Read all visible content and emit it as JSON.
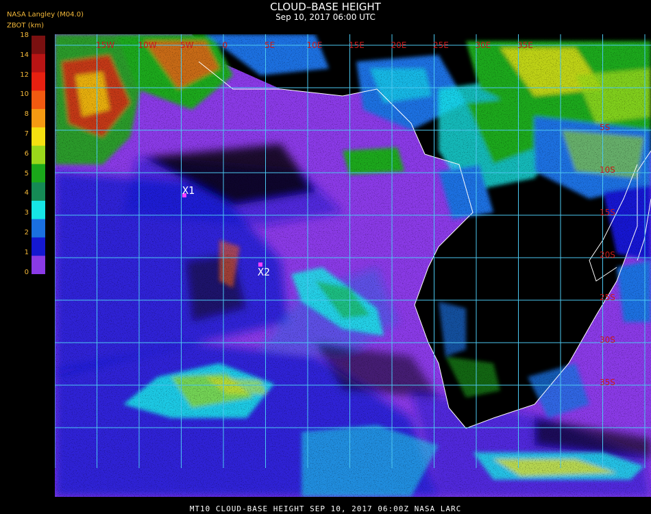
{
  "header": {
    "source": "NASA Langley (M04.0)",
    "units": "ZBOT (km)",
    "title": "CLOUD–BASE HEIGHT",
    "subtitle": "Sep 10, 2017 06:00 UTC"
  },
  "colorbar": {
    "ticks": [
      "18",
      "14",
      "12",
      "10",
      "8",
      "7",
      "6",
      "5",
      "4",
      "3",
      "2",
      "1",
      "0"
    ],
    "colors": [
      "#7a1010",
      "#b81414",
      "#e82010",
      "#f25a10",
      "#f59a12",
      "#f5e010",
      "#9ad71a",
      "#1aa81a",
      "#158a55",
      "#16e6e6",
      "#1a70e0",
      "#1418d0",
      "#8a3ae6"
    ]
  },
  "map": {
    "lon_labels": [
      "15W",
      "10W",
      "5W",
      "0",
      "5E",
      "10E",
      "15E",
      "20E",
      "25E",
      "30E",
      "35E"
    ],
    "lat_labels": [
      "5S",
      "10S",
      "15S",
      "20S",
      "25S",
      "30S",
      "35S"
    ],
    "markers": [
      {
        "label": "X1"
      },
      {
        "label": "X2"
      }
    ],
    "colors": {
      "ocean_clear": "#8a3ae6",
      "land": "#000000",
      "grid": "#4cc8f0",
      "coast": "#ffffff",
      "marker": "#ff40ff"
    }
  },
  "footer": {
    "text": "MT10  CLOUD-BASE HEIGHT   SEP 10, 2017 06:00Z   NASA LARC"
  }
}
